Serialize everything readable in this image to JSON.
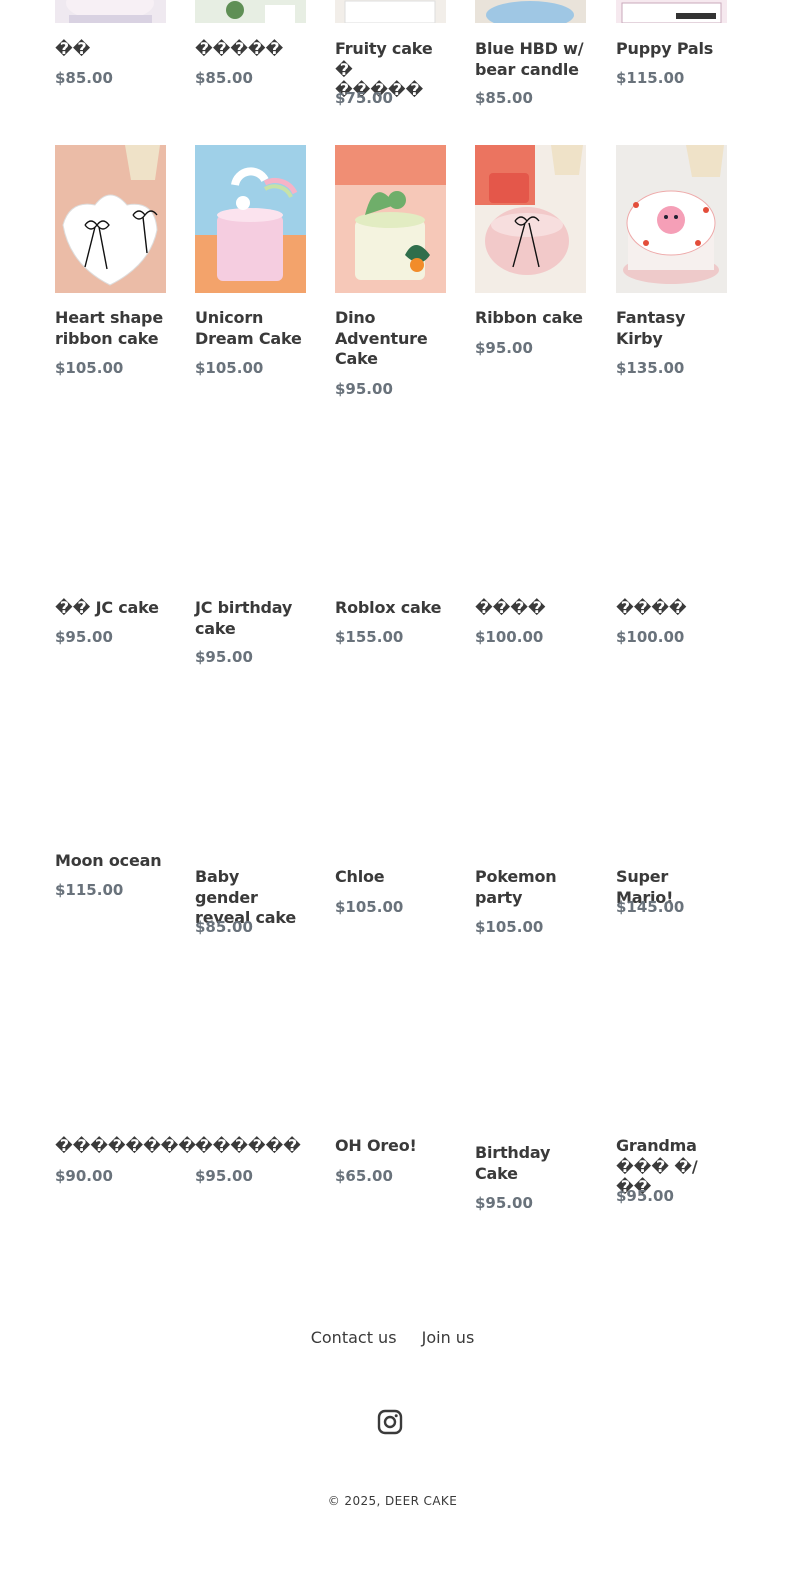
{
  "store_name": "DEER CAKE",
  "rows": [
    [
      {
        "title": "��",
        "price": "$85.00"
      },
      {
        "title": "�����",
        "price": "$85.00"
      },
      {
        "title": "Fruity cake � �����",
        "price": "$75.00"
      },
      {
        "title": "Blue HBD w/ bear candle",
        "price": "$85.00"
      },
      {
        "title": "Puppy Pals",
        "price": "$115.00"
      }
    ],
    [
      {
        "title": "Heart shape ribbon cake",
        "price": "$105.00"
      },
      {
        "title": "Unicorn Dream Cake",
        "price": "$105.00"
      },
      {
        "title": "Dino Adventure Cake",
        "price": "$95.00"
      },
      {
        "title": "Ribbon cake",
        "price": "$95.00"
      },
      {
        "title": "Fantasy Kirby",
        "price": "$135.00"
      }
    ],
    [
      {
        "title": "�� JC cake",
        "price": "$95.00"
      },
      {
        "title": "JC birthday cake",
        "price": "$95.00"
      },
      {
        "title": "Roblox cake",
        "price": "$155.00"
      },
      {
        "title": "����",
        "price": "$100.00"
      },
      {
        "title": "����",
        "price": "$100.00"
      }
    ],
    [
      {
        "title": "Moon ocean",
        "price": "$115.00"
      },
      {
        "title": "Baby gender reveal cake",
        "price": "$85.00"
      },
      {
        "title": "Chloe",
        "price": "$105.00"
      },
      {
        "title": "Pokemon party",
        "price": "$105.00"
      },
      {
        "title": "Super Mario!",
        "price": "$145.00"
      }
    ],
    [
      {
        "title": "��������",
        "price": "$90.00"
      },
      {
        "title": "������",
        "price": "$95.00"
      },
      {
        "title": "OH Oreo!",
        "price": "$65.00"
      },
      {
        "title": "Birthday Cake",
        "price": "$95.00"
      },
      {
        "title": "Grandma ��� �/��",
        "price": "$95.00"
      }
    ]
  ],
  "footer": {
    "links": [
      "Contact us",
      "Join us"
    ],
    "social_icon": "instagram-icon",
    "copyright": "© 2025, DEER CAKE"
  }
}
